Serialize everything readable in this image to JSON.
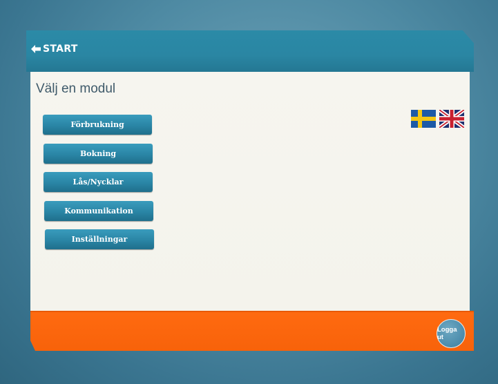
{
  "header": {
    "start_label": "START",
    "start_icon": "arrow-left-icon"
  },
  "main": {
    "title": "Välj en modul",
    "modules": [
      {
        "label": "Förbrukning"
      },
      {
        "label": "Bokning"
      },
      {
        "label": "Lås/Nycklar"
      },
      {
        "label": "Kommunikation"
      },
      {
        "label": "Inställningar"
      }
    ],
    "languages": [
      "swedish-flag-icon",
      "uk-flag-icon"
    ]
  },
  "footer": {
    "logout_label": "Logga ut"
  },
  "colors": {
    "header_blue": "#2a86a3",
    "button_blue": "#2a85a5",
    "content_bg": "#f5f4ee",
    "footer_orange": "#f7620a",
    "title_text": "#3f5a6a"
  }
}
